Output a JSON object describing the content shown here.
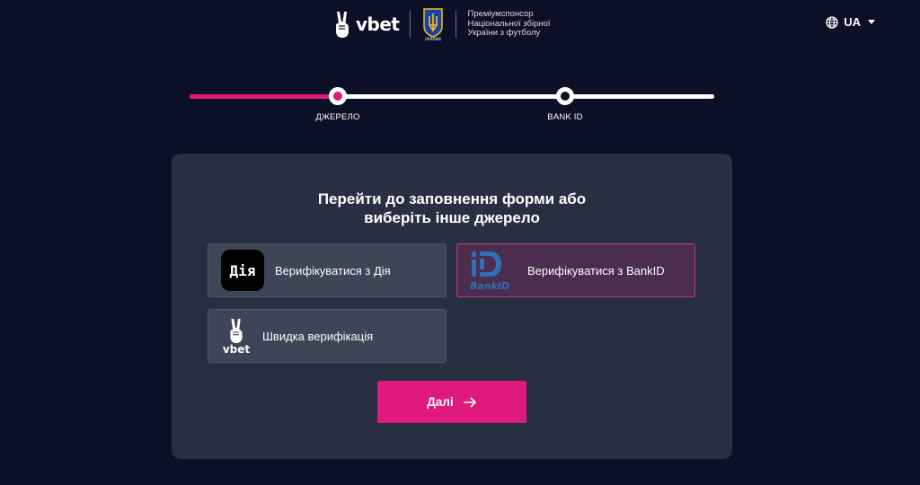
{
  "header": {
    "brand_name": "vbet",
    "sponsor_text": [
      "Преміумспонсор",
      "Національної збірної",
      "України з футболу"
    ],
    "crest_text": "UKRAINE",
    "language": "UA",
    "icons": {
      "language": "globe-icon",
      "language_menu": "caret-down-icon"
    }
  },
  "stepper": {
    "progress": 0.28,
    "steps": [
      {
        "label": "ДЖЕРЕЛО",
        "state": "active"
      },
      {
        "label": "BANK ID",
        "state": "pending"
      }
    ]
  },
  "card": {
    "title_lines": [
      "Перейти до заповнення форми або",
      "виберіть інше джерело"
    ],
    "options": [
      {
        "id": "diia",
        "label": "Верифікуватися з Дія",
        "icon_text": "Дія",
        "selected": false
      },
      {
        "id": "bankid",
        "label": "Верифікуватися з BankID",
        "icon_text": "BankID",
        "selected": true
      },
      {
        "id": "quick",
        "label": "Швидка верифікація",
        "icon_text": "vbet",
        "selected": false
      }
    ],
    "next_button": {
      "label": "Далі",
      "icon": "arrow-right-icon"
    }
  },
  "colors": {
    "background": "#0c1026",
    "card": "#272f40",
    "accent": "#e0197d",
    "option": "#3d4556",
    "option_selected": "#4b2d4e"
  }
}
